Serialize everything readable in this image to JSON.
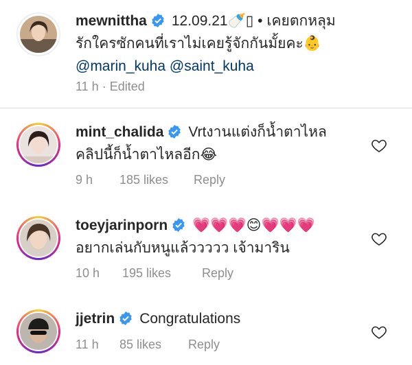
{
  "caption": {
    "username": "mewnittha",
    "line1": "12.09.21🍼▯ • เคยตกหลุม",
    "line2": "รักใครซักคนที่เราไม่เคยรู้จักกันมั้ยคะ👶",
    "mentions": "@marin_kuha @saint_kuha",
    "time": "11 h",
    "edited": "Edited"
  },
  "comments": [
    {
      "username": "mint_chalida",
      "line1": "Vrtงานแต่งก็น้ำตาไหล",
      "line2": "คลิปนี้ก็น้ำตาไหลอีก😂",
      "time": "9 h",
      "likes": "185 likes",
      "reply": "Reply"
    },
    {
      "username": "toeyjarinporn",
      "line1": "💗💗💗😊💗💗💗",
      "line2": "อยากเล่นกับหนูแล้ววววว เจ้ามาริน",
      "time": "10 h",
      "likes": "195 likes",
      "reply": "Reply"
    },
    {
      "username": "jjetrin",
      "line1": "Congratulations",
      "time": "11 h",
      "likes": "85 likes",
      "reply": "Reply"
    }
  ],
  "icons": {
    "verified": "verified-badge-icon",
    "like": "heart-outline-icon"
  },
  "colors": {
    "verified": "#3897f0",
    "mention": "#00376b",
    "meta": "#8e8e8e",
    "text": "#262626",
    "divider": "#dbdbdb"
  }
}
